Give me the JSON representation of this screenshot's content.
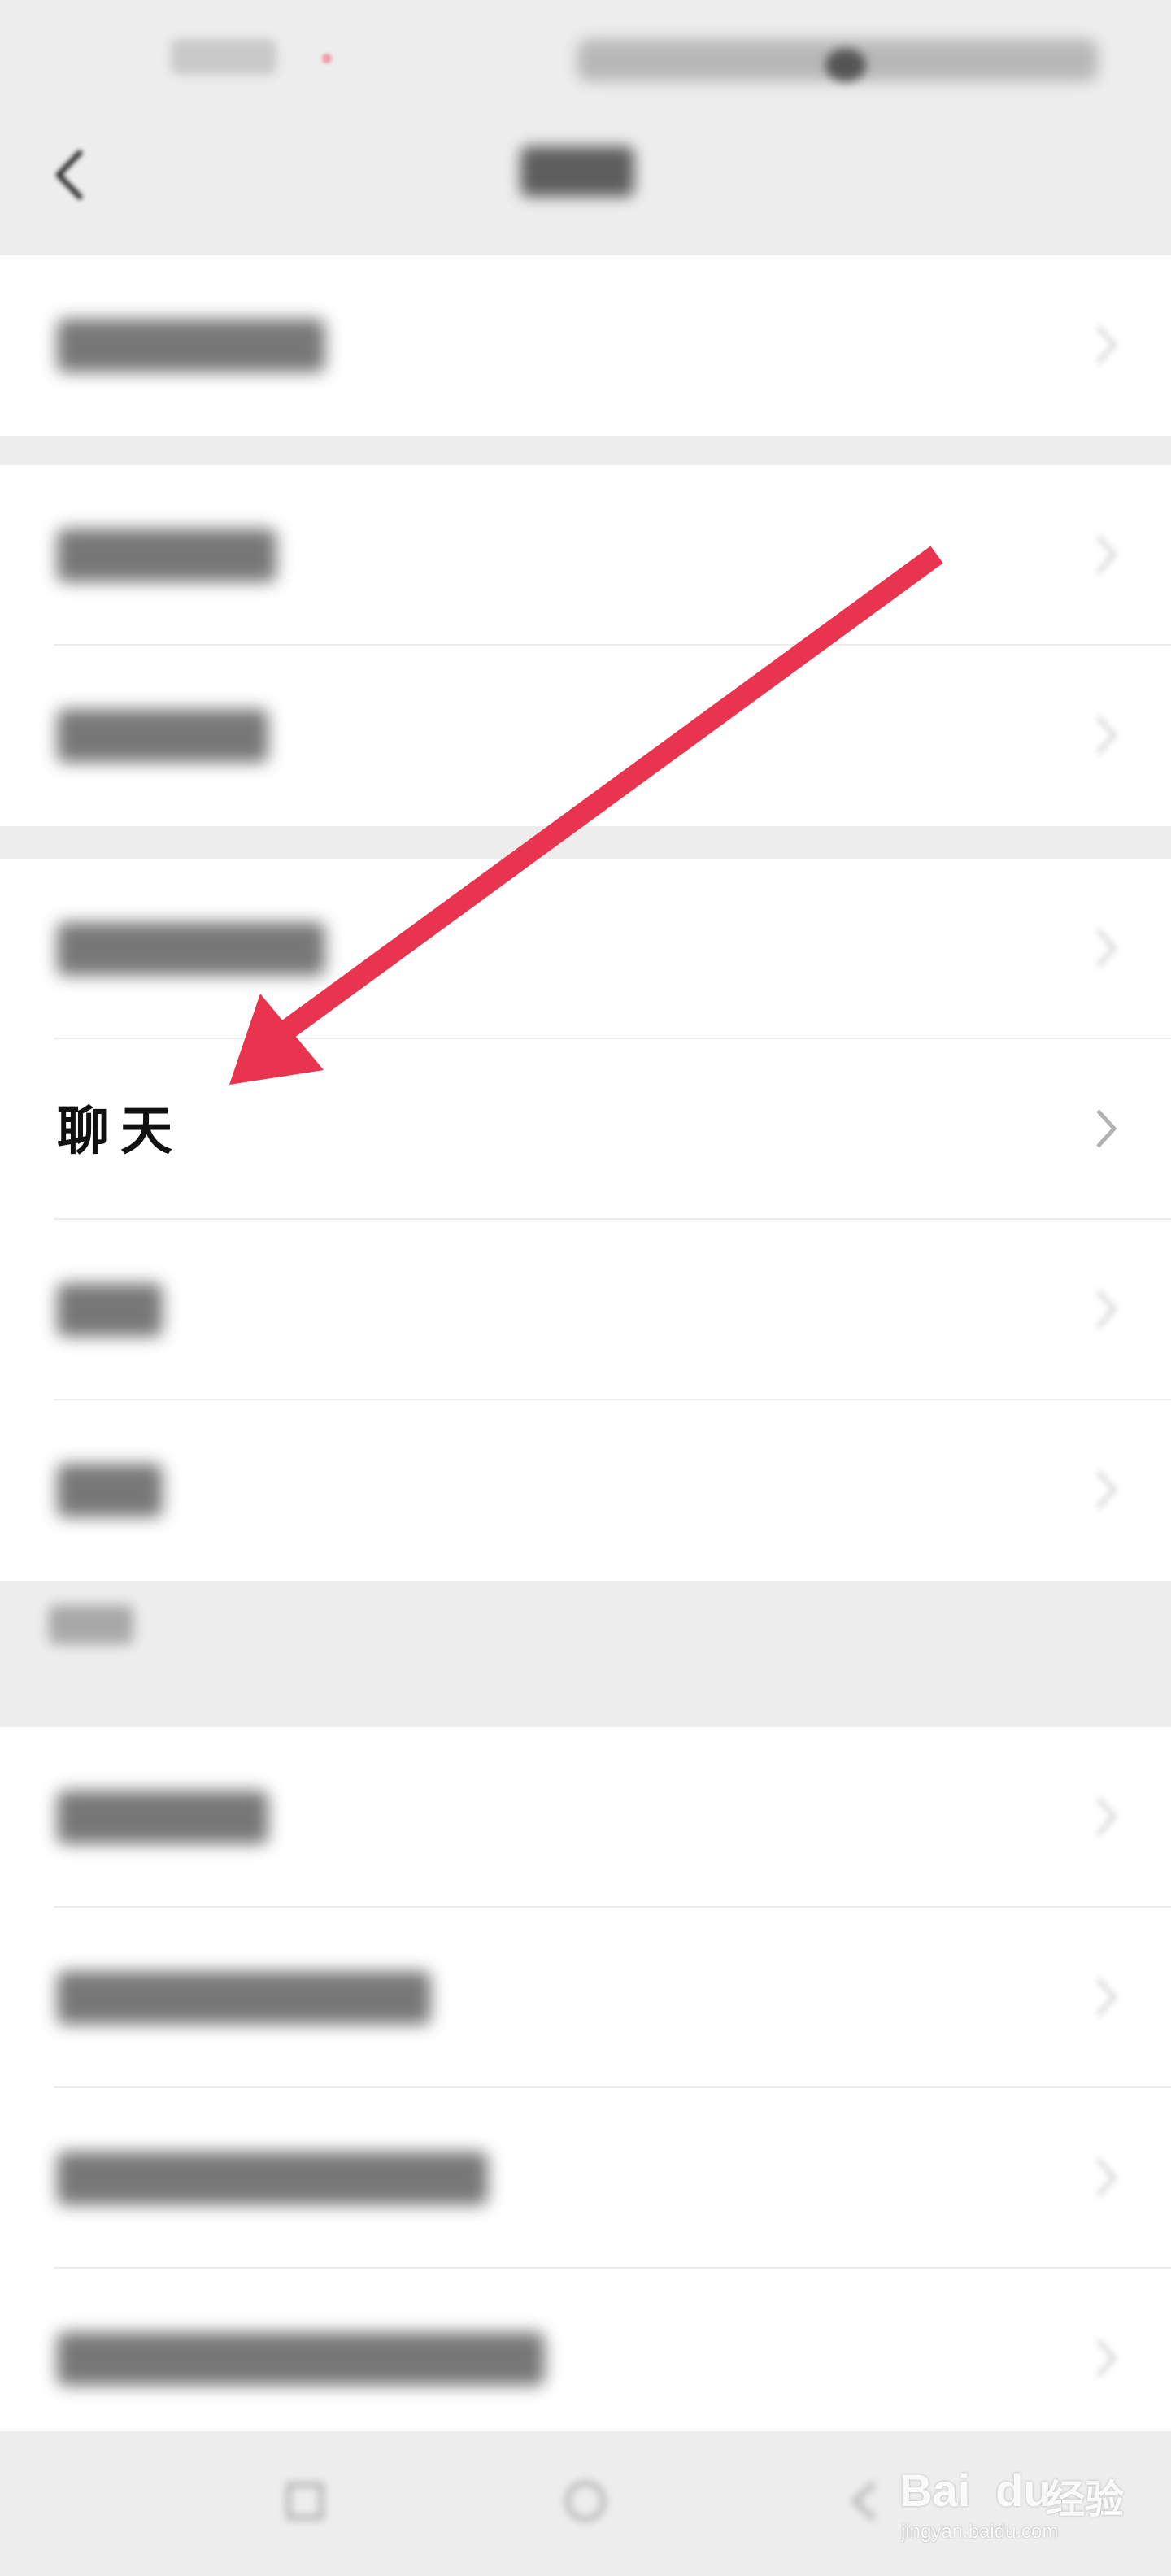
{
  "settings_list": {
    "highlighted_item": {
      "label": "聊天"
    }
  },
  "annotation": {
    "arrow_color": "#e8344e"
  },
  "watermark": {
    "logo": "Bai  du",
    "brand": "经验",
    "url": "jingyan.baidu.com"
  },
  "colors": {
    "background": "#ededed",
    "list_background": "#ffffff",
    "divider": "#ececec",
    "chevron": "#b2b2b2"
  }
}
